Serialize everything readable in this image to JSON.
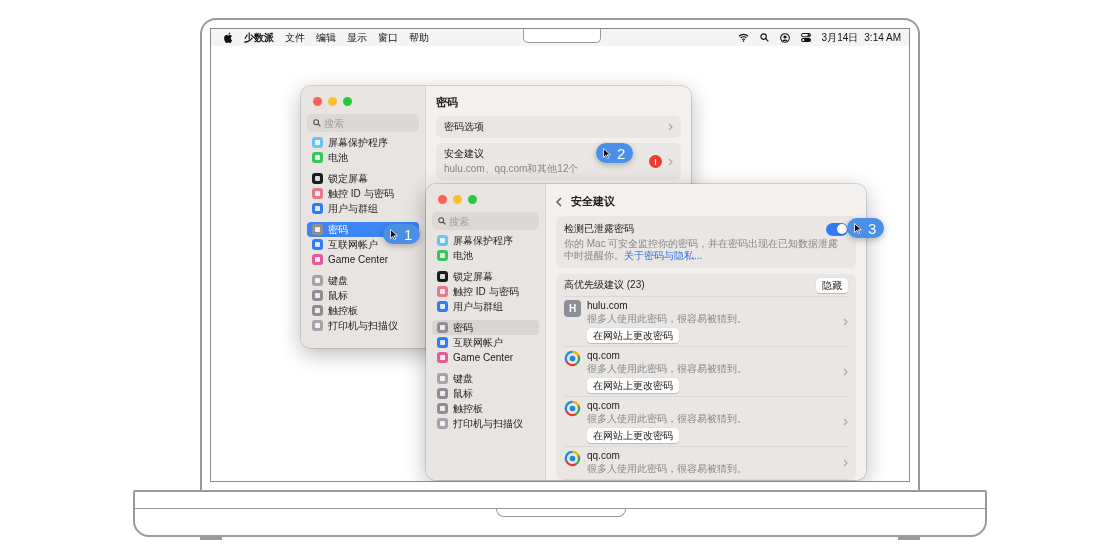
{
  "menu_bar": {
    "app_name": "少数派",
    "menus": [
      "文件",
      "编辑",
      "显示",
      "窗口",
      "帮助"
    ],
    "date": "3月14日",
    "time": "3:14 AM"
  },
  "password_window": {
    "focused": true,
    "search": {
      "placeholder": "搜索"
    },
    "sidebar": {
      "groups": [
        {
          "items": [
            {
              "label": "屏幕保护程序",
              "color": "#6cc3f0",
              "selected": false
            },
            {
              "label": "电池",
              "color": "#34c759",
              "selected": false
            }
          ]
        },
        {
          "items": [
            {
              "label": "锁定屏幕",
              "color": "#1c1c1e",
              "selected": false
            },
            {
              "label": "触控 ID 与密码",
              "color": "#e7788a",
              "selected": false
            },
            {
              "label": "用户与群组",
              "color": "#2f7cf6",
              "selected": false
            }
          ]
        },
        {
          "items": [
            {
              "label": "密码",
              "color": "#8e8e93",
              "selected": true
            },
            {
              "label": "互联网帐户",
              "color": "#2f7cf6",
              "selected": false
            },
            {
              "label": "Game Center",
              "color": "#e65a9c",
              "selected": false
            }
          ]
        },
        {
          "items": [
            {
              "label": "键盘",
              "color": "#a3a3a8",
              "selected": false
            },
            {
              "label": "鼠标",
              "color": "#8e8e93",
              "selected": false
            },
            {
              "label": "触控板",
              "color": "#8e8e93",
              "selected": false
            },
            {
              "label": "打印机与扫描仪",
              "color": "#a3a3a8",
              "selected": false
            }
          ]
        }
      ]
    },
    "title": "密码",
    "rows": [
      {
        "title": "密码选项"
      },
      {
        "title": "安全建议",
        "subtitle": "hulu.com、qq.com和其他12个",
        "alert_badge": "!"
      }
    ]
  },
  "security_window": {
    "focused": false,
    "search": {
      "placeholder": "搜索"
    },
    "sidebar": {
      "groups": [
        {
          "items": [
            {
              "label": "屏幕保护程序",
              "color": "#6cc3f0",
              "selected": false
            },
            {
              "label": "电池",
              "color": "#34c759",
              "selected": false
            }
          ]
        },
        {
          "items": [
            {
              "label": "锁定屏幕",
              "color": "#1c1c1e",
              "selected": false
            },
            {
              "label": "触控 ID 与密码",
              "color": "#e7788a",
              "selected": false
            },
            {
              "label": "用户与群组",
              "color": "#2f7cf6",
              "selected": false
            }
          ]
        },
        {
          "items": [
            {
              "label": "密码",
              "color": "#8e8e93",
              "selected": true
            },
            {
              "label": "互联网帐户",
              "color": "#2f7cf6",
              "selected": false
            },
            {
              "label": "Game Center",
              "color": "#e65a9c",
              "selected": false
            }
          ]
        },
        {
          "items": [
            {
              "label": "键盘",
              "color": "#a3a3a8",
              "selected": false
            },
            {
              "label": "鼠标",
              "color": "#8e8e93",
              "selected": false
            },
            {
              "label": "触控板",
              "color": "#8e8e93",
              "selected": false
            },
            {
              "label": "打印机与扫描仪",
              "color": "#a3a3a8",
              "selected": false
            }
          ]
        }
      ]
    },
    "title": "安全建议",
    "detect_card": {
      "title": "检测已泄露密码",
      "on": true,
      "description": "你的 Mac 可安全监控你的密码，并在密码出现在已知数据泄露中时提醒你。",
      "link": "关于密码与隐私..."
    },
    "recommendations": {
      "title": "高优先级建议 (23)",
      "hide_button": "隐藏",
      "items": [
        {
          "kind": "letter",
          "icon_letter": "H",
          "site": "hulu.com",
          "note": "很多人使用此密码，很容易被猜到。",
          "button": "在网站上更改密码"
        },
        {
          "kind": "logo",
          "site": "qq.com",
          "note": "很多人使用此密码，很容易被猜到。",
          "button": "在网站上更改密码"
        },
        {
          "kind": "logo",
          "site": "qq.com",
          "note": "很多人使用此密码，很容易被猜到。",
          "button": "在网站上更改密码"
        },
        {
          "kind": "logo",
          "site": "qq.com",
          "note": "很多人使用此密码，很容易被猜到。"
        }
      ]
    }
  },
  "callouts": [
    "1",
    "2",
    "3"
  ]
}
